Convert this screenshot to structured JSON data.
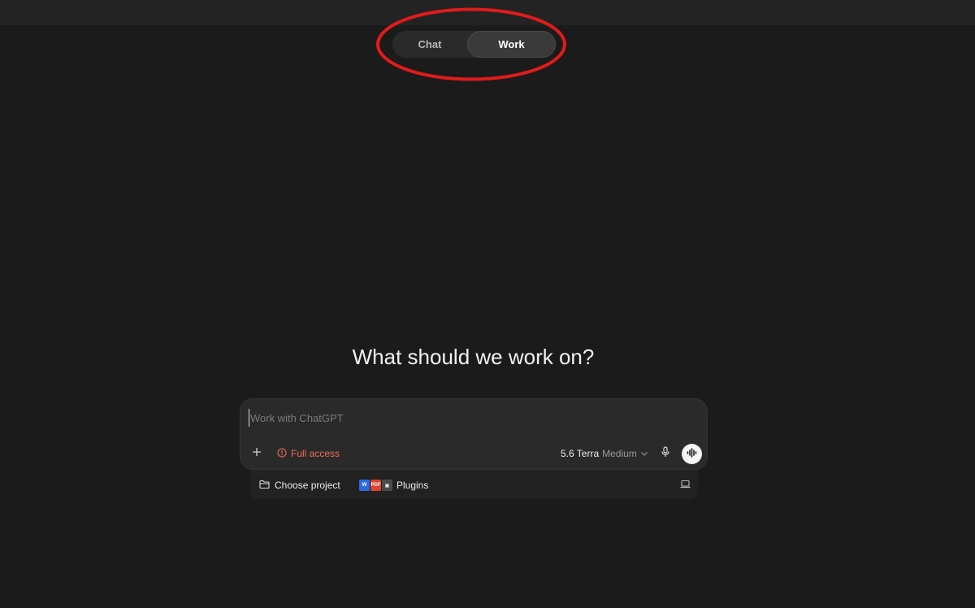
{
  "mode_toggle": {
    "tabs": [
      {
        "label": "Chat",
        "selected": false
      },
      {
        "label": "Work",
        "selected": true
      }
    ]
  },
  "annotation": {
    "color": "#e11b1b",
    "icon": "ellipse-highlight"
  },
  "main": {
    "heading": "What should we work on?"
  },
  "composer": {
    "placeholder": "Work with ChatGPT",
    "value": "",
    "add_icon": "plus-icon",
    "access_label": "Full access",
    "access_icon": "alert-circle-icon",
    "access_color": "#f06a55",
    "model_name": "5.6 Terra",
    "model_effort": "Medium",
    "mic_icon": "microphone-icon",
    "voice_icon": "voice-waveform-icon"
  },
  "bottom_bar": {
    "project_label": "Choose project",
    "project_icon": "folder-icon",
    "plugins_label": "Plugins",
    "plugin_icons": [
      "word-icon",
      "pdf-icon",
      "app-icon"
    ],
    "device_icon": "laptop-icon"
  }
}
